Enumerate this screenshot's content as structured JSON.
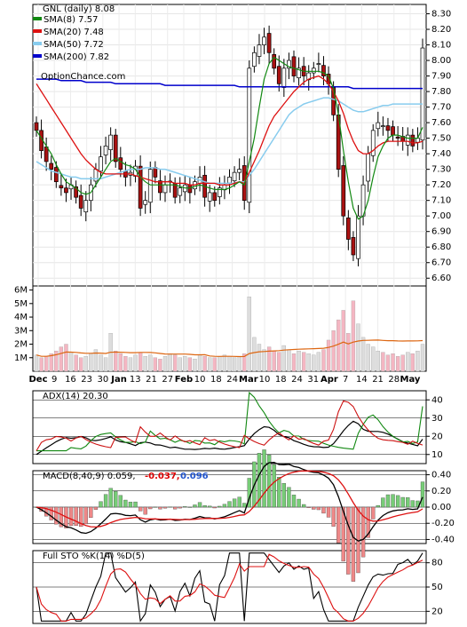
{
  "chart_data": [
    {
      "type": "candlestick",
      "ticker_label": "GNL (daily) 8.08",
      "source_label": "OptionChance.com",
      "legend": [
        {
          "label": "SMA(8) 7.57",
          "color": "#118811"
        },
        {
          "label": "SMA(20) 7.48",
          "color": "#dd1111"
        },
        {
          "label": "SMA(50) 7.72",
          "color": "#88ccee"
        },
        {
          "label": "SMA(200) 7.82",
          "color": "#0000cc"
        }
      ],
      "x_ticks": [
        "Dec",
        "9",
        "16",
        "23",
        "30",
        "Jan",
        "13",
        "21",
        "27",
        "Feb",
        "10",
        "18",
        "24",
        "Mar",
        "10",
        "18",
        "24",
        "31",
        "Apr",
        "7",
        "14",
        "21",
        "28",
        "May"
      ],
      "price_ticks": [
        "8.30",
        "8.20",
        "8.10",
        "8.00",
        "7.90",
        "7.80",
        "7.70",
        "7.60",
        "7.50",
        "7.40",
        "7.30",
        "7.20",
        "7.10",
        "7.00",
        "6.90",
        "6.80",
        "6.70",
        "6.60"
      ],
      "ylim": [
        6.55,
        8.36
      ],
      "volume_ticks": [
        "6M",
        "5M",
        "4M",
        "3M",
        "2M",
        "1M"
      ],
      "close": [
        7.55,
        7.42,
        7.35,
        7.3,
        7.22,
        7.18,
        7.15,
        7.2,
        7.12,
        7.05,
        7.1,
        7.2,
        7.3,
        7.38,
        7.45,
        7.52,
        7.35,
        7.3,
        7.25,
        7.28,
        7.32,
        7.05,
        7.1,
        7.3,
        7.25,
        7.15,
        7.2,
        7.22,
        7.12,
        7.18,
        7.2,
        7.15,
        7.22,
        7.25,
        7.12,
        7.15,
        7.1,
        7.18,
        7.2,
        7.25,
        7.28,
        7.3,
        7.1,
        7.95,
        8.05,
        8.1,
        8.15,
        8.05,
        7.95,
        7.85,
        7.95,
        8.0,
        7.9,
        7.95,
        7.9,
        7.92,
        7.95,
        7.98,
        7.9,
        7.85,
        7.65,
        7.3,
        7.0,
        6.85,
        6.75,
        7.0,
        7.2,
        7.4,
        7.55,
        7.6,
        7.58,
        7.55,
        7.52,
        7.5,
        7.48,
        7.52,
        7.45,
        7.5,
        8.08
      ],
      "sma8": [
        7.55,
        7.5,
        7.45,
        7.4,
        7.33,
        7.27,
        7.22,
        7.2,
        7.18,
        7.15,
        7.14,
        7.15,
        7.2,
        7.25,
        7.3,
        7.35,
        7.37,
        7.35,
        7.33,
        7.32,
        7.3,
        7.25,
        7.22,
        7.2,
        7.2,
        7.2,
        7.2,
        7.2,
        7.2,
        7.19,
        7.18,
        7.18,
        7.19,
        7.2,
        7.19,
        7.18,
        7.17,
        7.17,
        7.17,
        7.18,
        7.2,
        7.22,
        7.2,
        7.35,
        7.5,
        7.7,
        7.88,
        7.98,
        8.02,
        8.0,
        7.98,
        7.96,
        7.95,
        7.94,
        7.93,
        7.93,
        7.93,
        7.93,
        7.92,
        7.9,
        7.82,
        7.65,
        7.42,
        7.22,
        7.05,
        6.98,
        7.0,
        7.1,
        7.25,
        7.38,
        7.45,
        7.5,
        7.52,
        7.52,
        7.51,
        7.5,
        7.5,
        7.5,
        7.57
      ],
      "sma20": [
        7.85,
        7.8,
        7.75,
        7.7,
        7.65,
        7.6,
        7.55,
        7.5,
        7.45,
        7.4,
        7.36,
        7.33,
        7.3,
        7.28,
        7.27,
        7.27,
        7.27,
        7.27,
        7.27,
        7.27,
        7.26,
        7.25,
        7.24,
        7.23,
        7.22,
        7.22,
        7.22,
        7.22,
        7.21,
        7.21,
        7.21,
        7.2,
        7.2,
        7.21,
        7.21,
        7.21,
        7.21,
        7.2,
        7.2,
        7.2,
        7.21,
        7.22,
        7.21,
        7.28,
        7.35,
        7.42,
        7.5,
        7.58,
        7.64,
        7.68,
        7.72,
        7.76,
        7.8,
        7.83,
        7.86,
        7.88,
        7.89,
        7.9,
        7.88,
        7.85,
        7.8,
        7.74,
        7.66,
        7.56,
        7.48,
        7.42,
        7.4,
        7.4,
        7.42,
        7.45,
        7.47,
        7.48,
        7.48,
        7.48,
        7.48,
        7.48,
        7.47,
        7.47,
        7.48
      ],
      "sma50": [
        7.35,
        7.33,
        7.31,
        7.29,
        7.28,
        7.27,
        7.26,
        7.25,
        7.25,
        7.24,
        7.24,
        7.24,
        7.24,
        7.24,
        7.25,
        7.26,
        7.27,
        7.28,
        7.29,
        7.3,
        7.3,
        7.3,
        7.31,
        7.31,
        7.31,
        7.3,
        7.3,
        7.29,
        7.28,
        7.27,
        7.26,
        7.25,
        7.24,
        7.23,
        7.22,
        7.21,
        7.21,
        7.21,
        7.21,
        7.21,
        7.21,
        7.22,
        7.22,
        7.26,
        7.3,
        7.35,
        7.4,
        7.45,
        7.5,
        7.55,
        7.6,
        7.65,
        7.68,
        7.7,
        7.72,
        7.73,
        7.74,
        7.75,
        7.76,
        7.76,
        7.75,
        7.74,
        7.72,
        7.7,
        7.68,
        7.67,
        7.67,
        7.68,
        7.69,
        7.7,
        7.71,
        7.71,
        7.72,
        7.72,
        7.72,
        7.72,
        7.72,
        7.72,
        7.72
      ],
      "sma200": [
        7.88,
        7.88,
        7.88,
        7.88,
        7.88,
        7.87,
        7.87,
        7.87,
        7.87,
        7.87,
        7.86,
        7.86,
        7.86,
        7.86,
        7.86,
        7.86,
        7.85,
        7.85,
        7.85,
        7.85,
        7.85,
        7.85,
        7.85,
        7.85,
        7.85,
        7.85,
        7.84,
        7.84,
        7.84,
        7.84,
        7.84,
        7.84,
        7.84,
        7.84,
        7.84,
        7.84,
        7.84,
        7.84,
        7.84,
        7.84,
        7.84,
        7.83,
        7.83,
        7.83,
        7.83,
        7.83,
        7.83,
        7.83,
        7.83,
        7.83,
        7.83,
        7.83,
        7.83,
        7.83,
        7.83,
        7.83,
        7.83,
        7.83,
        7.83,
        7.83,
        7.83,
        7.83,
        7.83,
        7.83,
        7.82,
        7.82,
        7.82,
        7.82,
        7.82,
        7.82,
        7.82,
        7.82,
        7.82,
        7.82,
        7.82,
        7.82,
        7.82,
        7.82,
        7.82
      ],
      "volume_m": [
        1.2,
        1.0,
        1.1,
        1.3,
        1.5,
        1.8,
        2.0,
        1.4,
        1.2,
        1.0,
        1.1,
        1.3,
        1.6,
        1.2,
        1.0,
        2.8,
        1.5,
        1.3,
        1.1,
        1.0,
        1.2,
        1.4,
        1.1,
        1.2,
        1.0,
        0.9,
        1.1,
        1.3,
        1.2,
        1.0,
        1.1,
        1.0,
        0.9,
        1.2,
        1.1,
        1.0,
        1.0,
        1.1,
        1.2,
        1.1,
        1.0,
        1.1,
        1.3,
        5.5,
        2.5,
        2.0,
        1.6,
        1.8,
        1.5,
        1.4,
        1.9,
        1.6,
        1.3,
        1.5,
        1.4,
        1.3,
        1.2,
        1.4,
        1.6,
        2.3,
        3.0,
        3.8,
        4.5,
        2.8,
        5.2,
        3.5,
        2.5,
        2.0,
        1.8,
        1.5,
        1.4,
        1.2,
        1.3,
        1.1,
        1.2,
        1.4,
        1.3,
        1.5,
        2.0
      ]
    },
    {
      "type": "line",
      "label": "ADX(14) 20.30",
      "ticks": [
        "40",
        "30",
        "20",
        "10"
      ],
      "ylim": [
        5,
        45
      ],
      "series": [
        {
          "name": "ADX(14)",
          "color": "#000000"
        },
        {
          "name": "+DI",
          "color": "#118811"
        },
        {
          "name": "-DI",
          "color": "#cc1111"
        }
      ]
    },
    {
      "type": "line",
      "label": "MACD(8,40,9) 0.059,",
      "label_red": "-0.037,",
      "label_blue": "0.096",
      "ticks": [
        "0.40",
        "0.20",
        "0.00",
        "-0.20",
        "-0.40"
      ],
      "ylim": [
        -0.45,
        0.45
      ]
    },
    {
      "type": "line",
      "label": "Full STO %K(14) %D(5)",
      "ticks": [
        "80",
        "50",
        "20"
      ],
      "ylim": [
        5,
        95
      ]
    }
  ]
}
